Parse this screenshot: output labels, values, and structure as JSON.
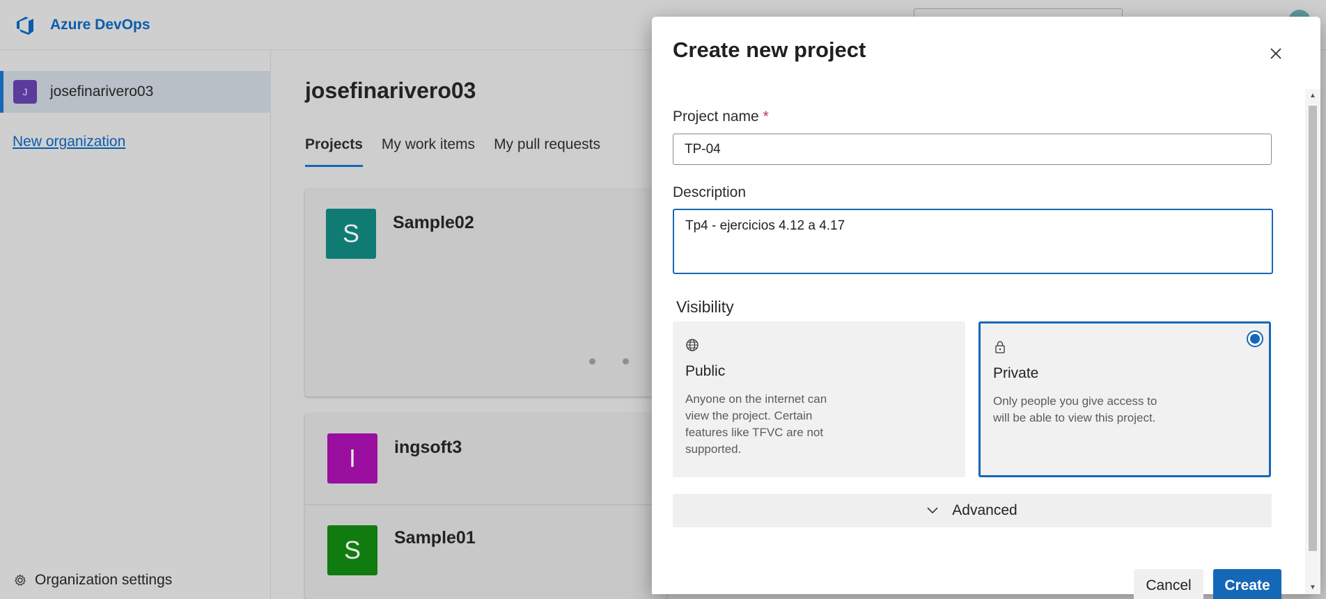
{
  "header": {
    "brand": "Azure DevOps",
    "logo_icon": "azure-devops-logo"
  },
  "sidebar": {
    "org_initial": "J",
    "org_name": "josefinarivero03",
    "new_org_link": "New organization",
    "settings_label": "Organization settings",
    "settings_icon": "gear-icon"
  },
  "main": {
    "title": "josefinarivero03",
    "tabs": [
      {
        "label": "Projects",
        "active": true
      },
      {
        "label": "My work items",
        "active": false
      },
      {
        "label": "My pull requests",
        "active": false
      }
    ],
    "projects": [
      {
        "initial": "S",
        "name": "Sample02",
        "color": "#0f7b73"
      },
      {
        "initial": "I",
        "name": "ingsoft3",
        "color": "#9a0f9f"
      },
      {
        "initial": "S",
        "name": "Sample01",
        "color": "#107c10"
      }
    ]
  },
  "dialog": {
    "title": "Create new project",
    "close_icon": "close-icon",
    "project_name_label": "Project name",
    "required_marker": "*",
    "project_name_value": "TP-04",
    "description_label": "Description",
    "description_value": "Tp4 - ejercicios 4.12 a 4.17",
    "visibility_label": "Visibility",
    "visibility_options": [
      {
        "icon": "globe-icon",
        "title": "Public",
        "description": "Anyone on the internet can view the project. Certain features like TFVC are not supported.",
        "selected": false
      },
      {
        "icon": "lock-icon",
        "title": "Private",
        "description": "Only people you give access to will be able to view this project.",
        "selected": true
      }
    ],
    "advanced_label": "Advanced",
    "cancel_label": "Cancel",
    "create_label": "Create"
  },
  "colors": {
    "accent": "#1567b8",
    "required": "#c4314b"
  }
}
